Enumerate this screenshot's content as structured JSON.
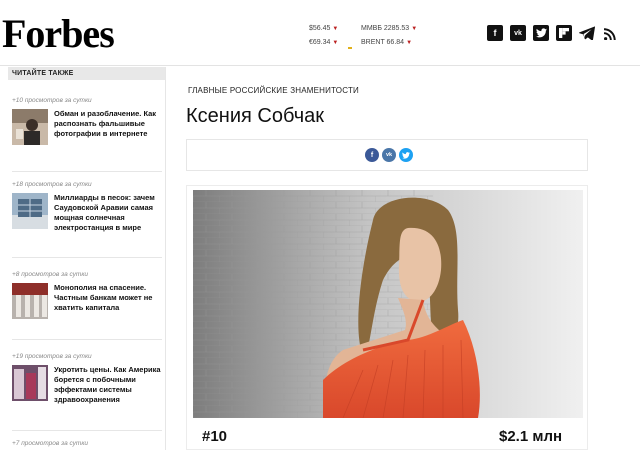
{
  "header": {
    "logo": "Forbes",
    "rates": [
      {
        "label": "$56.45"
      },
      {
        "label": "€69.34"
      }
    ],
    "indices": [
      {
        "label": "ММВБ 2285.53"
      },
      {
        "label": "BRENT 66.84"
      }
    ],
    "social": [
      "facebook-icon",
      "vk-icon",
      "twitter-icon",
      "flipboard-icon",
      "telegram-icon",
      "rss-icon"
    ]
  },
  "sidebar": {
    "heading": "ЧИТАЙТЕ ТАКЖЕ",
    "items": [
      {
        "views": "+10 просмотров за сутки",
        "title": "Обман и разоблачение. Как распознать фальшивые фотографии в интернете"
      },
      {
        "views": "+18 просмотров за сутки",
        "title": "Миллиарды в песок: зачем Саудовской Аравии самая мощная солнечная электростанция в мире"
      },
      {
        "views": "+8 просмотров за сутки",
        "title": "Монополия на спасение. Частным банкам может не хватить капитала"
      },
      {
        "views": "+19 просмотров за сутки",
        "title": "Укротить цены. Как Америка борется с побочными эффектами системы здравоохранения"
      },
      {
        "views": "+7 просмотров за сутки",
        "title": ""
      }
    ]
  },
  "main": {
    "category": "ГЛАВНЫЕ РОССИЙСКИЕ ЗНАМЕНИТОСТИ",
    "title": "Ксения Собчак",
    "rank": "#10",
    "worth": "$2.1 млн"
  },
  "colors": {
    "facebook": "#3b5998",
    "vk": "#4a76a8",
    "twitter": "#1da1f2",
    "rate_arrow": "#b22222",
    "accent_mark": "#e1b11a"
  }
}
